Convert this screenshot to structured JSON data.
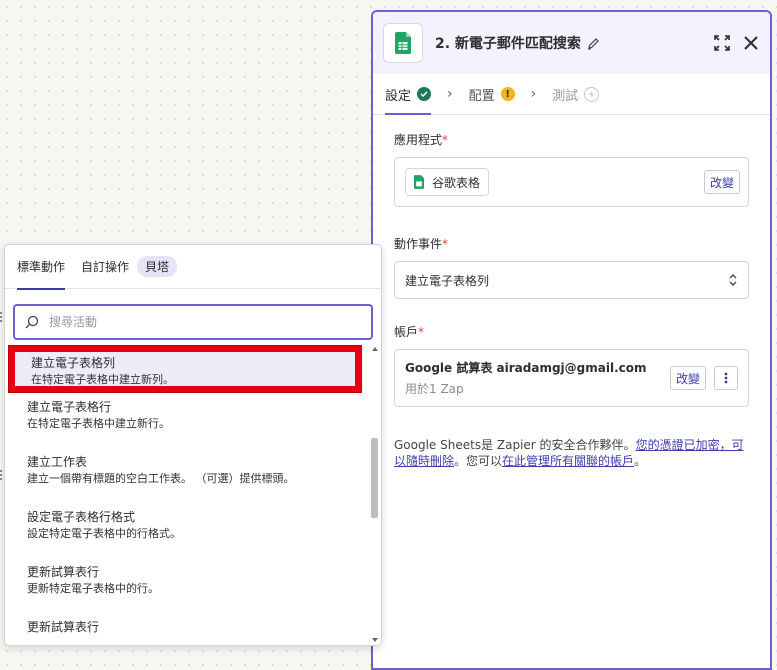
{
  "panel": {
    "step_title": "2. 新電子郵件匹配搜索",
    "tabs": [
      {
        "label": "設定"
      },
      {
        "label": "配置"
      },
      {
        "label": "測試"
      }
    ],
    "app_field": {
      "label": "應用程式",
      "value": "谷歌表格",
      "change_label": "改變"
    },
    "event_field": {
      "label": "動作事件",
      "value": "建立電子表格列"
    },
    "account_field": {
      "label": "帳戶",
      "name": "Google 試算表 airadamgj@gmail.com",
      "usage": "用於1 Zap",
      "change_label": "改變"
    },
    "note": {
      "text1": "Google Sheets是 Zapier 的安全合作夥伴。",
      "link1": "您的憑證已加密，可以隨時刪除",
      "text2": "。您可以",
      "link2": "在此管理所有關聯的帳戶",
      "text3": "。"
    }
  },
  "popover": {
    "tabs": {
      "standard": "標準動作",
      "custom": "自訂操作",
      "beta": "貝塔"
    },
    "search_placeholder": "搜尋活動",
    "items": [
      {
        "title": "建立電子表格列",
        "desc": "在特定電子表格中建立新列。"
      },
      {
        "title": "建立電子表格行",
        "desc": "在特定電子表格中建立新行。"
      },
      {
        "title": "建立工作表",
        "desc": "建立一個帶有標題的空白工作表。 （可選）提供標頭。"
      },
      {
        "title": "設定電子表格行格式",
        "desc": "設定特定電子表格中的行格式。"
      },
      {
        "title": "更新試算表行",
        "desc": "更新特定電子表格中的行。"
      },
      {
        "title": "更新試算表行",
        "desc": ""
      }
    ]
  },
  "colors": {
    "accent": "#6b5fd3",
    "highlight_box": "#e60012",
    "success": "#1d7a54",
    "warning": "#f2b51b",
    "sheets_green": "#1fa463"
  },
  "icons": [
    "google-sheets-icon",
    "pencil-icon",
    "expand-icon",
    "close-icon",
    "check-icon",
    "warning-icon",
    "test-icon",
    "chevron-right-icon",
    "search-icon",
    "up-down-icon",
    "kebab-icon"
  ]
}
